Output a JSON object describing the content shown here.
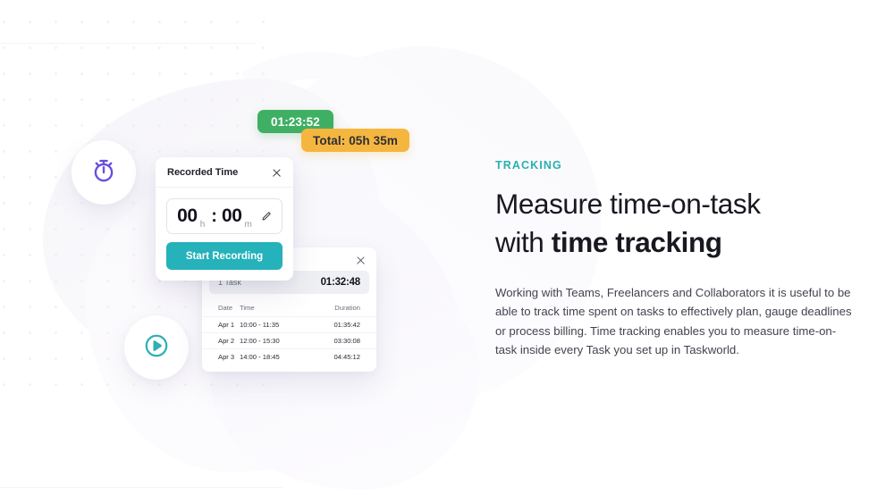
{
  "badges": {
    "timer": "01:23:52",
    "total": "Total: 05h 35m",
    "timer_color": "#3faf63",
    "total_color": "#f5b63f"
  },
  "recorded_card": {
    "title": "Recorded Time",
    "close_icon": "close-icon",
    "hours_value": "00",
    "hours_unit": "h",
    "separator": ":",
    "minutes_value": "00",
    "minutes_unit": "m",
    "edit_icon": "pencil-icon",
    "start_button_label": "Start Recording",
    "button_color": "#25b2ba"
  },
  "timelog_card": {
    "close_icon": "close-icon",
    "task_count": "1 Task",
    "task_total_time": "01:32:48",
    "columns": [
      "Date",
      "Time",
      "Duration"
    ],
    "rows": [
      {
        "date": "Apr 1",
        "time": "10:00 - 11:35",
        "duration": "01:35:42"
      },
      {
        "date": "Apr 2",
        "time": "12:00 - 15:30",
        "duration": "03:30:08"
      },
      {
        "date": "Apr 3",
        "time": "14:00 - 18:45",
        "duration": "04:45:12"
      }
    ]
  },
  "floating_icons": {
    "stopwatch": {
      "name": "stopwatch-icon",
      "color": "#6a4fdb"
    },
    "play": {
      "name": "play-circle-icon",
      "color": "#2eb0b5"
    }
  },
  "content": {
    "eyebrow": "TRACKING",
    "eyebrow_color": "#29b0b0",
    "headline_part1": "Measure time-on-task",
    "headline_part2": "with ",
    "headline_strong": "time tracking",
    "body": "Working with Teams, Freelancers and Collaborators it is useful to be able to track time spent on tasks to effectively plan, gauge deadlines or process billing. Time tracking enables you to measure time-on-task inside every Task you set up in Taskworld."
  }
}
